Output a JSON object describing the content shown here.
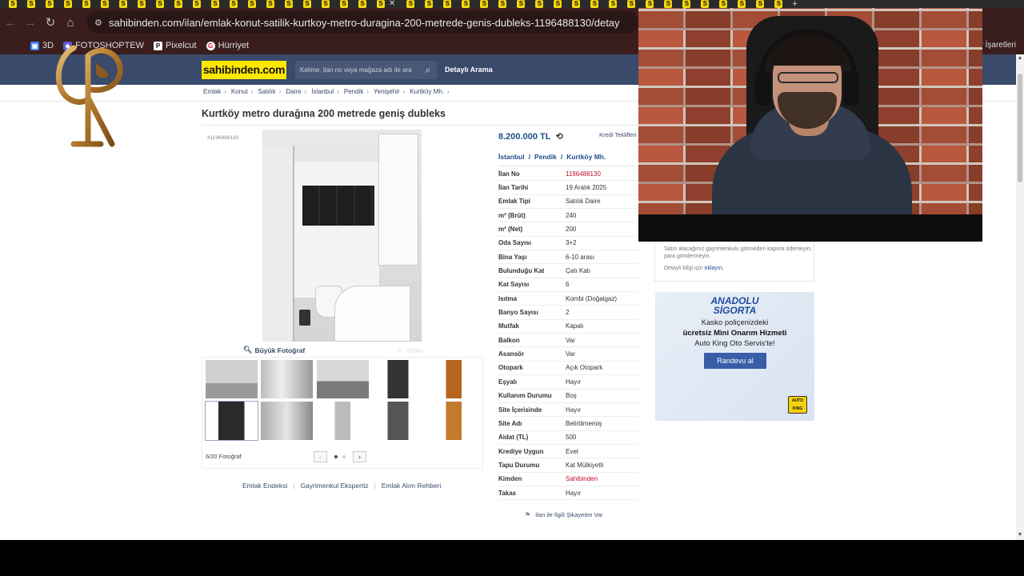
{
  "browser": {
    "tab_favicon_letter": "S",
    "tab_count": 42,
    "url": "sahibinden.com/ilan/emlak-konut-satilik-kurtkoy-metro-duragina-200-metrede-genis-dubleks-1196488130/detay",
    "bookmarks": [
      {
        "label": "3D",
        "icon": "cube-icon",
        "color": "#3b82f6"
      },
      {
        "label": "FOTOSHOPTEW",
        "icon": "app-icon",
        "color": "#5b5bd6"
      },
      {
        "label": "Pixelcut",
        "icon": "pixelcut-icon",
        "color": "#ffffff"
      },
      {
        "label": "Hürriyet",
        "icon": "hurriyet-icon",
        "color": "#e11d2e"
      }
    ],
    "bookmarks_right": "Yer İşaretleri"
  },
  "site": {
    "logo": "sahibinden.com",
    "search_placeholder": "Kelime, ilan no veya mağaza adı ile ara",
    "advanced_search": "Detaylı Arama",
    "breadcrumbs": [
      "Emlak",
      "Konut",
      "Satılık",
      "Daire",
      "İstanbul",
      "Pendik",
      "Yenişehir",
      "Kurtköy Mh."
    ]
  },
  "listing": {
    "title": "Kurtköy metro durağına 200 metrede geniş dubleks",
    "id_small": "#1196488130",
    "price": "8.200.000 TL",
    "credit_link": "Kredi Teklifleri",
    "location": [
      "İstanbul",
      "Pendik",
      "Kurtköy Mh."
    ],
    "properties": [
      {
        "k": "İlan No",
        "v": "1196488130",
        "red": true
      },
      {
        "k": "İlan Tarihi",
        "v": "19 Aralık 2025"
      },
      {
        "k": "Emlak Tipi",
        "v": "Satılık Daire"
      },
      {
        "k": "m² (Brüt)",
        "v": "240"
      },
      {
        "k": "m² (Net)",
        "v": "200"
      },
      {
        "k": "Oda Sayısı",
        "v": "3+2"
      },
      {
        "k": "Bina Yaşı",
        "v": "6-10 arası"
      },
      {
        "k": "Bulunduğu Kat",
        "v": "Çatı Katı"
      },
      {
        "k": "Kat Sayısı",
        "v": "6"
      },
      {
        "k": "Isıtma",
        "v": "Kombi (Doğalgaz)"
      },
      {
        "k": "Banyo Sayısı",
        "v": "2"
      },
      {
        "k": "Mutfak",
        "v": "Kapalı"
      },
      {
        "k": "Balkon",
        "v": "Var"
      },
      {
        "k": "Asansör",
        "v": "Var"
      },
      {
        "k": "Otopark",
        "v": "Açık Otopark"
      },
      {
        "k": "Eşyalı",
        "v": "Hayır"
      },
      {
        "k": "Kullanım Durumu",
        "v": "Boş"
      },
      {
        "k": "Site İçerisinde",
        "v": "Hayır"
      },
      {
        "k": "Site Adı",
        "v": "Belirtilmemiş"
      },
      {
        "k": "Aidat (TL)",
        "v": "500"
      },
      {
        "k": "Krediye Uygun",
        "v": "Evet"
      },
      {
        "k": "Tapu Durumu",
        "v": "Kat Mülkiyetli"
      },
      {
        "k": "Kimden",
        "v": "Sahibinden",
        "red": true
      },
      {
        "k": "Takas",
        "v": "Hayır"
      }
    ],
    "big_photo": "Büyük Fotoğraf",
    "video": "Video",
    "photo_count": "6/20 Fotoğraf",
    "complaint": "İlan ile İlgili Şikayetim Var",
    "footer_links": [
      "Emlak Endeksi",
      "Gayrimenkul Ekspertiz",
      "Emlak Alım Rehberi"
    ]
  },
  "safety": {
    "text": "Satın alacağınız gayrimenkulu görmeden kapora ödemeyin, para göndermeyin.",
    "more_prefix": "Detaylı bilgi için",
    "more_link": "tıklayın."
  },
  "ad": {
    "brand_line1": "ANADOLU",
    "brand_line2": "SİGORTA",
    "line1": "Kasko poliçenizdeki",
    "line2": "ücretsiz Mini Onarım Hizmeti",
    "line3": "Auto King Oto Servis'te!",
    "button": "Randevu al",
    "badge": "AUTO KING"
  },
  "colors": {
    "header": "#3a4a6b",
    "logo_bg": "#ffe800",
    "price": "#1f4e8c",
    "red_value": "#c0102b",
    "toolbar": "#3a1e1e"
  }
}
